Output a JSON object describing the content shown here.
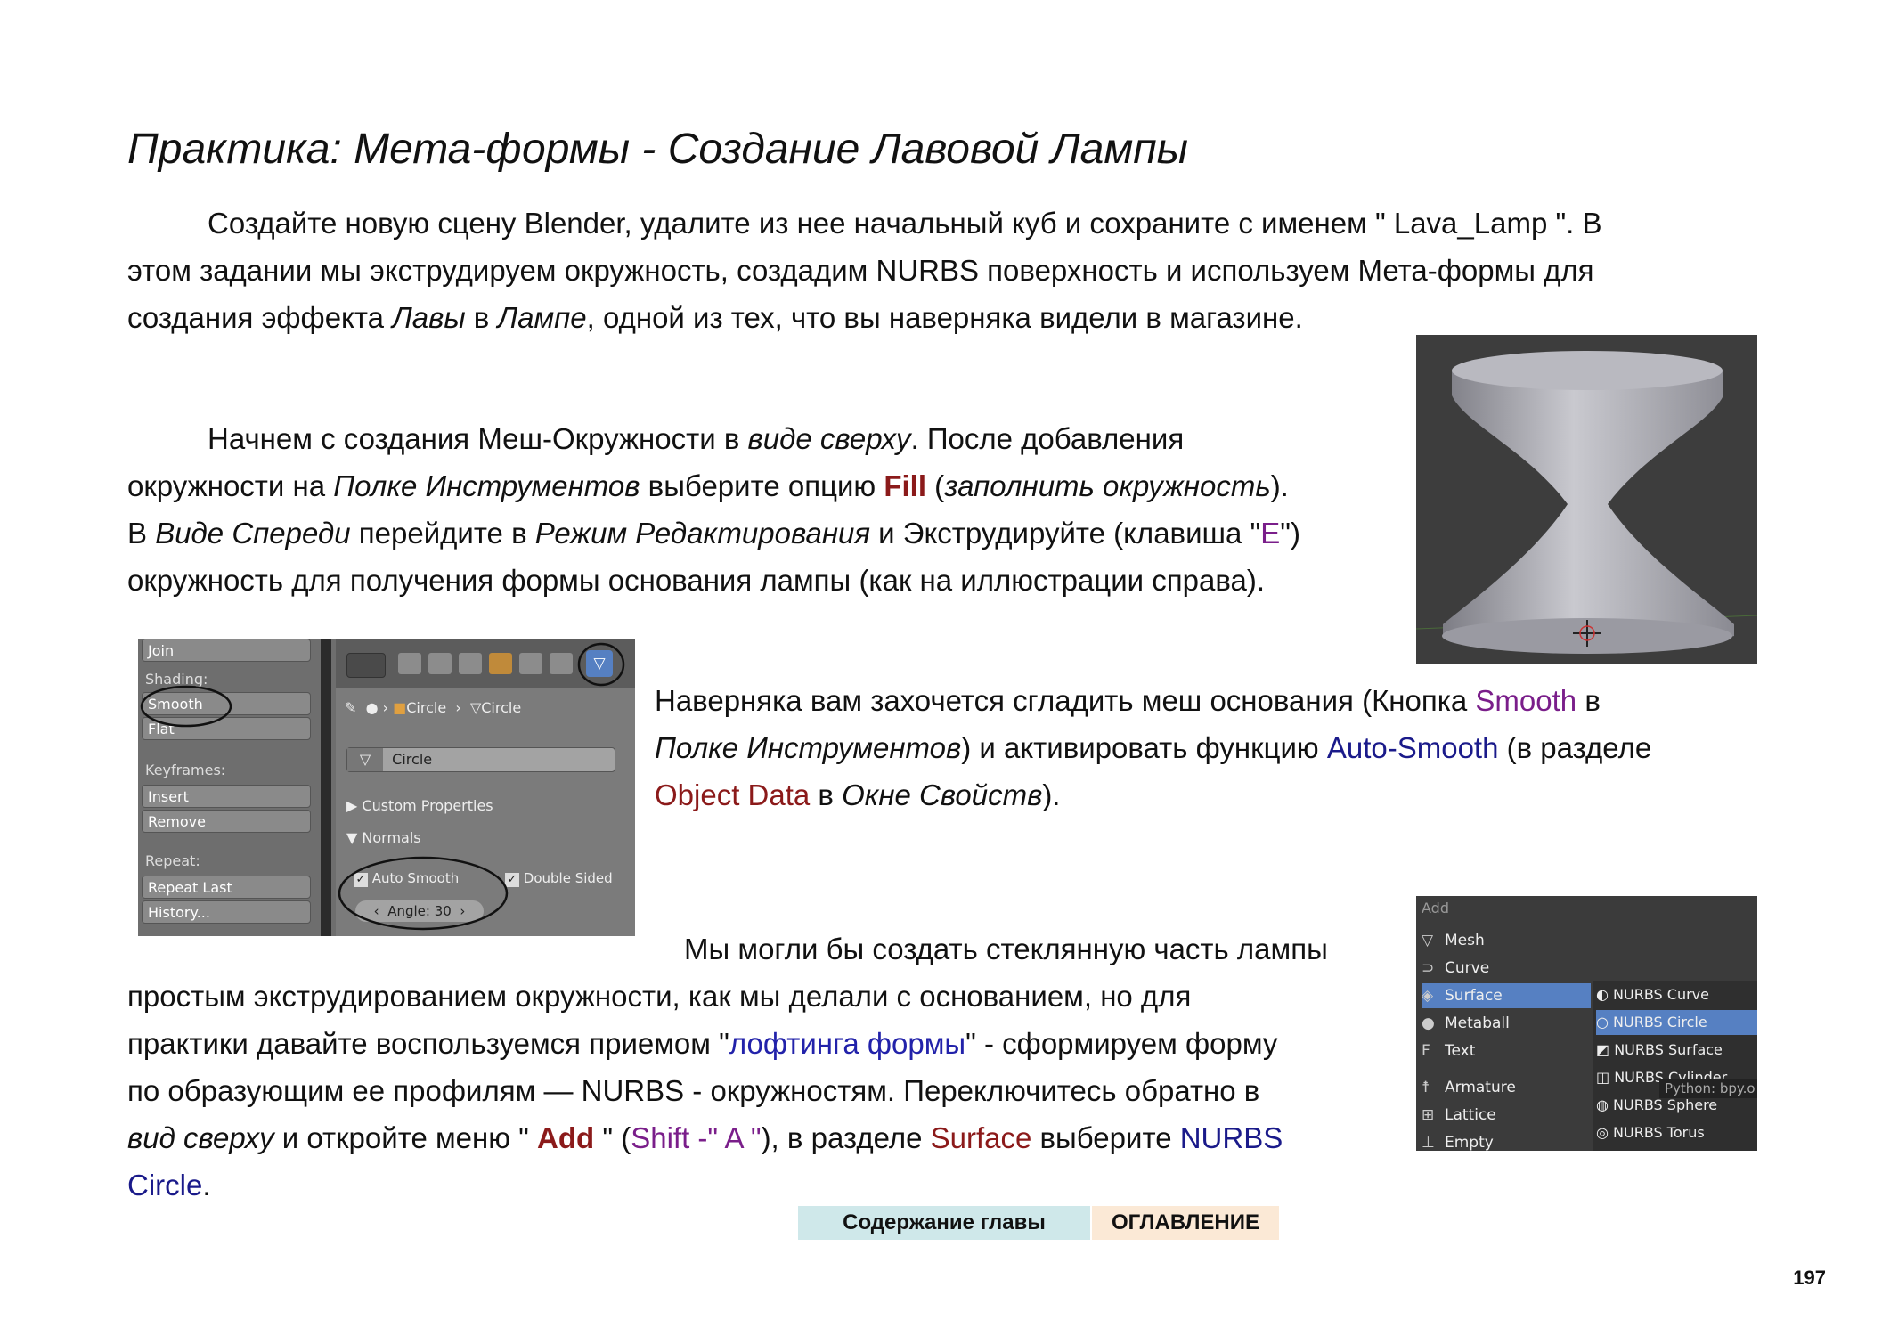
{
  "title": "Практика: Мета-формы - Создание Лавовой Лампы",
  "p1": {
    "l1": "Создайте новую сцену Blender, удалите из нее начальный куб и сохраните с именем \" Lava_Lamp \". В",
    "l2": "этом задании мы экструдируем окружность, создадим NURBS поверхность и используем Мета-формы для",
    "l3a": "создания эффекта ",
    "l3b": "Лавы",
    "l3c": " в ",
    "l3d": "Лампе",
    "l3e": ", одной из тех, что вы наверняка видели в магазине."
  },
  "p2": {
    "l1a": "Начнем с создания Меш-Окружности в ",
    "l1b": "виде сверху",
    "l1c": ". После добавления",
    "l2a": "окружности на ",
    "l2b": "Полке Инструментов",
    "l2c": " выберите опцию ",
    "l2d": "Fill",
    "l2e": " (",
    "l2f": "заполнить окружность",
    "l2g": ").",
    "l3a": "В ",
    "l3b": "Виде Спереди",
    "l3c": " перейдите в ",
    "l3d": "Режим Редактирования",
    "l3e": " и Экструдируйте (клавиша \"",
    "l3f": "E",
    "l3g": "\")",
    "l4": "окружность для получения формы основания лампы (как на иллюстрации справа)."
  },
  "p3": {
    "l1a": "Наверняка вам захочется сгладить меш основания (Кнопка ",
    "l1b": "Smooth",
    "l1c": " в",
    "l2a": "Полке Инструментов",
    "l2b": ") и активировать функцию ",
    "l2c": "Auto-Smooth",
    "l2d": " (в разделе",
    "l3a": "Object Data",
    "l3b": " в ",
    "l3c": "Окне Свойств",
    "l3d": ")."
  },
  "p4": {
    "l1": "Мы могли бы создать стеклянную часть лампы",
    "l2": "простым экструдированием окружности, как мы делали с основанием, но для",
    "l3a": "практики давайте воспользуемся приемом \"",
    "l3b": "лофтинга формы",
    "l3c": "\" - сформируем форму",
    "l4": "по образующим ее профилям — NURBS - окружностям. Переключитесь обратно в",
    "l5a": "вид сверху",
    "l5b": " и откройте меню \" ",
    "l5c": "Add",
    "l5d": " \" (",
    "l5e": "Shift -\" A \"",
    "l5f": "), в разделе ",
    "l5g": "Surface",
    "l5h": " выберите ",
    "l5i": "NURBS",
    "l6a": "Circle",
    "l6b": "."
  },
  "shelf": {
    "join": "Join",
    "shading": "Shading:",
    "smooth": "Smooth",
    "flat": "Flat",
    "keyframes": "Keyframes:",
    "insert": "Insert",
    "remove": "Remove",
    "repeat": "Repeat:",
    "repeat_last": "Repeat Last",
    "history": "History...",
    "crumb1": "Circle",
    "crumb2": "Circle",
    "name_field": "Circle",
    "custom_props": "Custom Properties",
    "normals": "Normals",
    "auto_smooth": "Auto Smooth",
    "double_sided": "Double Sided",
    "angle": "Angle: 30"
  },
  "menu": {
    "header": "Add",
    "items": [
      "Mesh",
      "Curve",
      "Surface",
      "Metaball",
      "Text",
      "Armature",
      "Lattice",
      "Empty"
    ],
    "sub": [
      "NURBS Curve",
      "NURBS Circle",
      "NURBS Surface",
      "NURBS Cylinder",
      "NURBS Sphere",
      "NURBS Torus"
    ],
    "tooltip": "Python: bpy.o"
  },
  "nav": {
    "chapter": "Содержание главы",
    "toc": "ОГЛАВЛЕНИЕ",
    "chapter_color": "#cfe8ea",
    "toc_color": "#fbe9d6"
  },
  "page_number": "197"
}
